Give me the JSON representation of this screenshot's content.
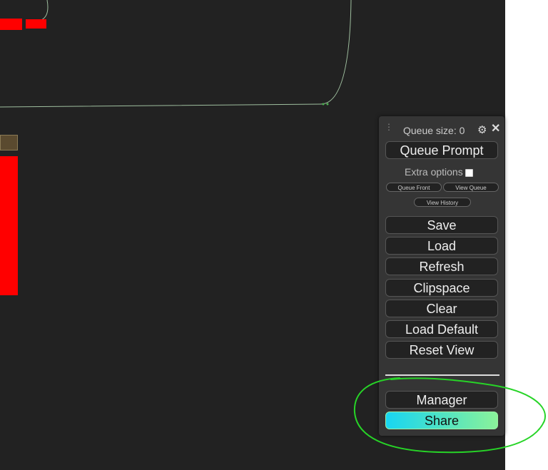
{
  "canvas": {
    "background": "#222222",
    "node_color": "#ff0000",
    "node_header_color": "#5a4a2f",
    "link_color": "#9fbf9f"
  },
  "menu": {
    "queue_size_label": "Queue size: 0",
    "drag_handle": "⋮",
    "gear_icon": "⚙",
    "close_icon": "✕",
    "queue_prompt": "Queue Prompt",
    "extra_options": "Extra options",
    "queue_front": "Queue Front",
    "view_queue": "View Queue",
    "view_history": "View History",
    "buttons": {
      "save": "Save",
      "load": "Load",
      "refresh": "Refresh",
      "clipspace": "Clipspace",
      "clear": "Clear",
      "load_default": "Load Default",
      "reset_view": "Reset View"
    },
    "manager": "Manager",
    "share": "Share"
  },
  "annotation": {
    "color": "#27d427"
  }
}
